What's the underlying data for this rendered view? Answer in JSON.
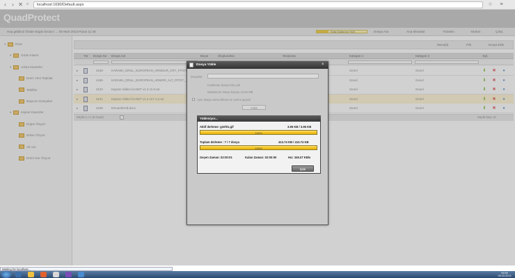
{
  "browser": {
    "url": "localhost:1690/Default.aspx",
    "status": "Waiting for localhost..."
  },
  "app": {
    "logo": "QuadProtect",
    "user_info": "Hoş geldiniz Önder Ergün Ercan / ... 05 Mart 2013 Pazar 11:48",
    "quota": "Kota Kullanımı %24",
    "quota_fraction": 0.24,
    "toolbar": [
      "Dosya Ara",
      "Ana Ekranlar",
      "Yönetim",
      "Yardım",
      "Çıkış"
    ]
  },
  "sidebar": {
    "items": [
      {
        "label": "Root",
        "level": 0
      },
      {
        "label": "Ortak Klasör",
        "level": 1
      },
      {
        "label": "Arkas Klasörler",
        "level": 1
      },
      {
        "label": "Erem Yeni Teşkilat",
        "level": 2
      },
      {
        "label": "Teklifler",
        "level": 2
      },
      {
        "label": "Başvuru Dosyaları",
        "level": 2
      },
      {
        "label": "Kişisel Klasörler",
        "level": 1
      },
      {
        "label": "Ergün Ösyurt",
        "level": 2
      },
      {
        "label": "Erkan Özyurt",
        "level": 2
      },
      {
        "label": "Ali can",
        "level": 2
      },
      {
        "label": "Erem Nur Özyurt",
        "level": 2
      }
    ]
  },
  "grid": {
    "toolbar": [
      "Menü(0)",
      "Filtr",
      "Dosya Ekle"
    ],
    "columns": [
      "Tür",
      "Dosya No",
      "Dosya Adı",
      "Boyut",
      "Oluşturulma",
      "Oluşturan",
      "Kategori 1",
      "Kategori 2",
      "Eyl."
    ],
    "rows": [
      {
        "no": "3158",
        "name": "KARABA_DRILL_EUROPEAN_ARMOUR_CRY_PITOT_...",
        "cat1": "Genel",
        "cat2": "Genel"
      },
      {
        "no": "4186",
        "name": "KARABA_DRILL_EUROPEAN_ARMOR_ALT_PITOT_...",
        "cat1": "Genel",
        "cat2": "Genel"
      },
      {
        "no": "3132",
        "name": "Kapsse Slides for.NET v1.3 v1.0.rar",
        "cat1": "Genel",
        "cat2": "Genel"
      },
      {
        "no": "3131",
        "name": "Kapsse Slides for.NET v1.3 v17.1.0.rar",
        "cat1": "Genel",
        "cat2": "Genel"
      },
      {
        "no": "4235",
        "name": "EGuardsFull.docx",
        "cat1": "Genel",
        "cat2": "Genel"
      }
    ],
    "pager": "Sayfa 1 / 1 (5 Kayıt)",
    "page_size": "Sayfa başı 10"
  },
  "dialog": {
    "title": "Dosya Yükle",
    "files_label": "Dosyalar:",
    "info1": "Kısıtlanan dosya türü yok",
    "info2": "Maksimum dosya boyutu 14,53 MB",
    "checkbox": "Aynı dosya varsa silinsin ve yerine geçsin",
    "upload_btn": "Yükle"
  },
  "progress": {
    "title": "Yükleniyor...",
    "active_label": "Aktif derleme: g3sf01.gif",
    "active_size": "3.95 KB / 3.95 KB",
    "active_percent": "100%",
    "active_fraction": 1.0,
    "total_label": "Toplam derleme : 7 / 7 dosya",
    "total_size": "413.74 KB / 413.74 KB",
    "total_percent": "100%",
    "total_fraction": 1.0,
    "elapsed": "Geçen Zaman: 02:00:01",
    "remaining": "Kalan Zaman: 02:00:00",
    "speed": "Hız: 345.07 KB/s",
    "cancel": "İptal"
  },
  "taskbar": {
    "time": "05:55",
    "date": "05.03.2013"
  }
}
